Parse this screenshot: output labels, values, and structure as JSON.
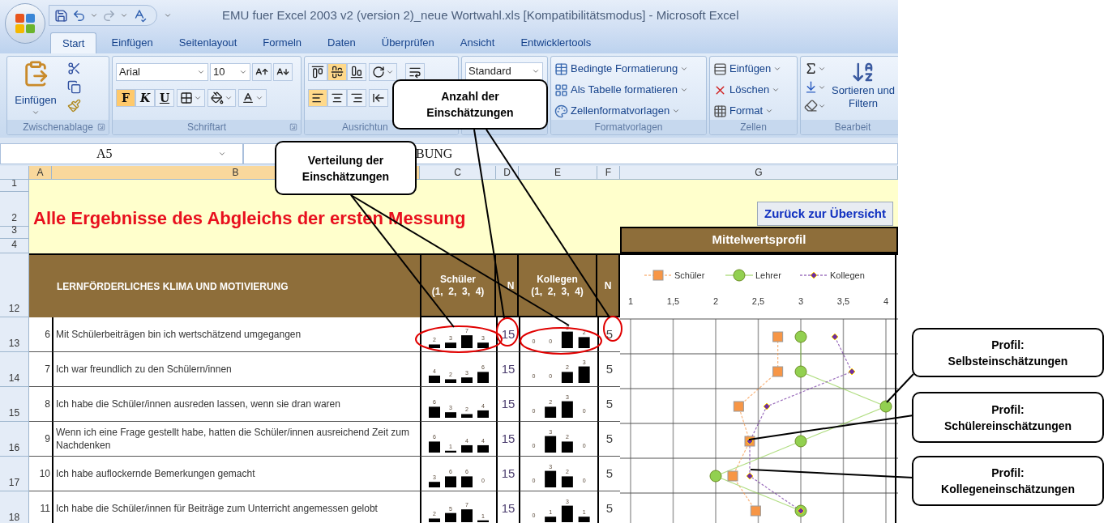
{
  "title_bar": {
    "title": "EMU fuer Excel 2003 v2 (version 2)_neue Wortwahl.xls [Kompatibilitätsmodus] - Microsoft Excel"
  },
  "ribbon_tabs": [
    {
      "label": "Start",
      "selected": true
    },
    {
      "label": "Einfügen",
      "selected": false
    },
    {
      "label": "Seitenlayout",
      "selected": false
    },
    {
      "label": "Formeln",
      "selected": false
    },
    {
      "label": "Daten",
      "selected": false
    },
    {
      "label": "Überprüfen",
      "selected": false
    },
    {
      "label": "Ansicht",
      "selected": false
    },
    {
      "label": "Entwicklertools",
      "selected": false
    }
  ],
  "ribbon": {
    "clipboard": {
      "paste": "Einfügen",
      "label": "Zwischenablage"
    },
    "font": {
      "name": "Arial",
      "size": "10",
      "styles": [
        {
          "label": "F",
          "on": true
        },
        {
          "label": "K",
          "on": false
        },
        {
          "label": "U",
          "on": false
        }
      ],
      "label": "Schriftart"
    },
    "alignment": {
      "vertical": [
        {
          "on": false
        },
        {
          "on": true
        },
        {
          "on": false
        }
      ],
      "horizontal": [
        {
          "on": true
        },
        {
          "on": false
        },
        {
          "on": false
        }
      ],
      "label": "Ausrichtun"
    },
    "number": {
      "format": "Standard"
    },
    "styles": {
      "items": [
        "Bedingte Formatierung",
        "Als Tabelle formatieren",
        "Zellenformatvorlagen"
      ],
      "label": "Formatvorlagen"
    },
    "cells": {
      "items": [
        "Einfügen",
        "Löschen",
        "Format"
      ],
      "label": "Zellen"
    },
    "editing": {
      "sort": "Sortieren und Filtern",
      "label": "Bearbeit"
    }
  },
  "formula_bar": {
    "name_box": "A5",
    "value": "BUNG"
  },
  "columns": [
    {
      "label": "A",
      "selected": true
    },
    {
      "label": "B",
      "selected": true
    },
    {
      "label": "C",
      "selected": false
    },
    {
      "label": "D",
      "selected": false
    },
    {
      "label": "E",
      "selected": false
    },
    {
      "label": "F",
      "selected": false
    },
    {
      "label": "G",
      "selected": false
    }
  ],
  "sheet": {
    "row_numbers": [
      "1",
      "2",
      "3",
      "4",
      "12"
    ],
    "title": "Alle Ergebnisse des Abgleichs der ersten Messung",
    "back_button": "Zurück zur Übersicht",
    "profile_title": "Mittelwertsprofil",
    "header": {
      "section": "LERNFÖRDERLICHES KLIMA UND MOTIVIERUNG",
      "students": "Schüler",
      "students_scale": "(1,  2,  3,  4)",
      "students_n": "N",
      "colleagues": "Kollegen",
      "colleagues_scale": "(1,  2,  3,  4)",
      "colleagues_n": "N"
    }
  },
  "items": [
    {
      "row": "13",
      "number": "6",
      "text": "Mit Schülerbeiträgen bin ich wertschätzend umgegangen",
      "students": [
        "2",
        "3",
        "7",
        "3"
      ],
      "students_n": "15",
      "colleagues": [
        "0",
        "0",
        "3",
        "2"
      ],
      "colleagues_n": "5"
    },
    {
      "row": "14",
      "number": "7",
      "text": "Ich war freundlich zu den Schülern/innen",
      "students": [
        "4",
        "2",
        "3",
        "6"
      ],
      "students_n": "15",
      "colleagues": [
        "0",
        "0",
        "2",
        "3"
      ],
      "colleagues_n": "5"
    },
    {
      "row": "15",
      "number": "8",
      "text": "Ich habe die Schüler/innen ausreden lassen, wenn sie dran waren",
      "students": [
        "6",
        "3",
        "2",
        "4"
      ],
      "students_n": "15",
      "colleagues": [
        "0",
        "2",
        "3",
        "0"
      ],
      "colleagues_n": "5"
    },
    {
      "row": "16",
      "number": "9",
      "text": "Wenn ich eine Frage gestellt habe, hatten die Schüler/innen ausreichend Zeit zum Nachdenken",
      "students": [
        "6",
        "1",
        "4",
        "4"
      ],
      "students_n": "15",
      "colleagues": [
        "0",
        "3",
        "2",
        "0"
      ],
      "colleagues_n": "5"
    },
    {
      "row": "17",
      "number": "10",
      "text": "Ich habe auflockernde Bemerkungen gemacht",
      "students": [
        "3",
        "6",
        "6",
        "0"
      ],
      "students_n": "15",
      "colleagues": [
        "0",
        "3",
        "2",
        "0"
      ],
      "colleagues_n": "5"
    },
    {
      "row": "18",
      "number": "11",
      "text": "Ich habe die Schüler/innen für Beiträge zum Unterricht angemessen gelobt",
      "students": [
        "2",
        "5",
        "7",
        "1"
      ],
      "students_n": "15",
      "colleagues": [
        "0",
        "1",
        "3",
        "1"
      ],
      "colleagues_n": "5"
    }
  ],
  "profile": {
    "chart_data": {
      "type": "line",
      "orientation": "horizontal",
      "grid": true,
      "legend": true,
      "xlim": [
        1,
        4
      ],
      "xticks": [
        {
          "value": 1,
          "label": "1"
        },
        {
          "value": 1.5,
          "label": "1,5"
        },
        {
          "value": 2,
          "label": "2"
        },
        {
          "value": 2.5,
          "label": "2,5"
        },
        {
          "value": 3,
          "label": "3"
        },
        {
          "value": 3.5,
          "label": "3,5"
        },
        {
          "value": 4,
          "label": "4"
        }
      ],
      "series": [
        {
          "name": "Schüler",
          "color": "#f79646",
          "line_style": "dashed",
          "marker": "square",
          "values": [
            2.73,
            2.73,
            2.27,
            2.4,
            2.2,
            2.47
          ]
        },
        {
          "name": "Lehrer",
          "color": "#92d050",
          "line_style": "solid",
          "marker": "circle",
          "values": [
            3,
            3,
            4,
            3,
            2,
            3
          ]
        },
        {
          "name": "Kollegen",
          "color": "#7030a0",
          "line_style": "dashed",
          "marker": "diamond",
          "values": [
            3.4,
            3.6,
            2.6,
            2.4,
            2.4,
            3
          ]
        }
      ]
    }
  },
  "callouts": [
    {
      "text": "Anzahl der\nEinschätzungen"
    },
    {
      "text": "Verteilung der\nEinschätzungen"
    },
    {
      "text": "Profil:\nSelbsteinschätzungen"
    },
    {
      "text": "Profil:\nSchülereinschätzungen"
    },
    {
      "text": "Profil:\nKollegeneinschätzungen"
    }
  ]
}
